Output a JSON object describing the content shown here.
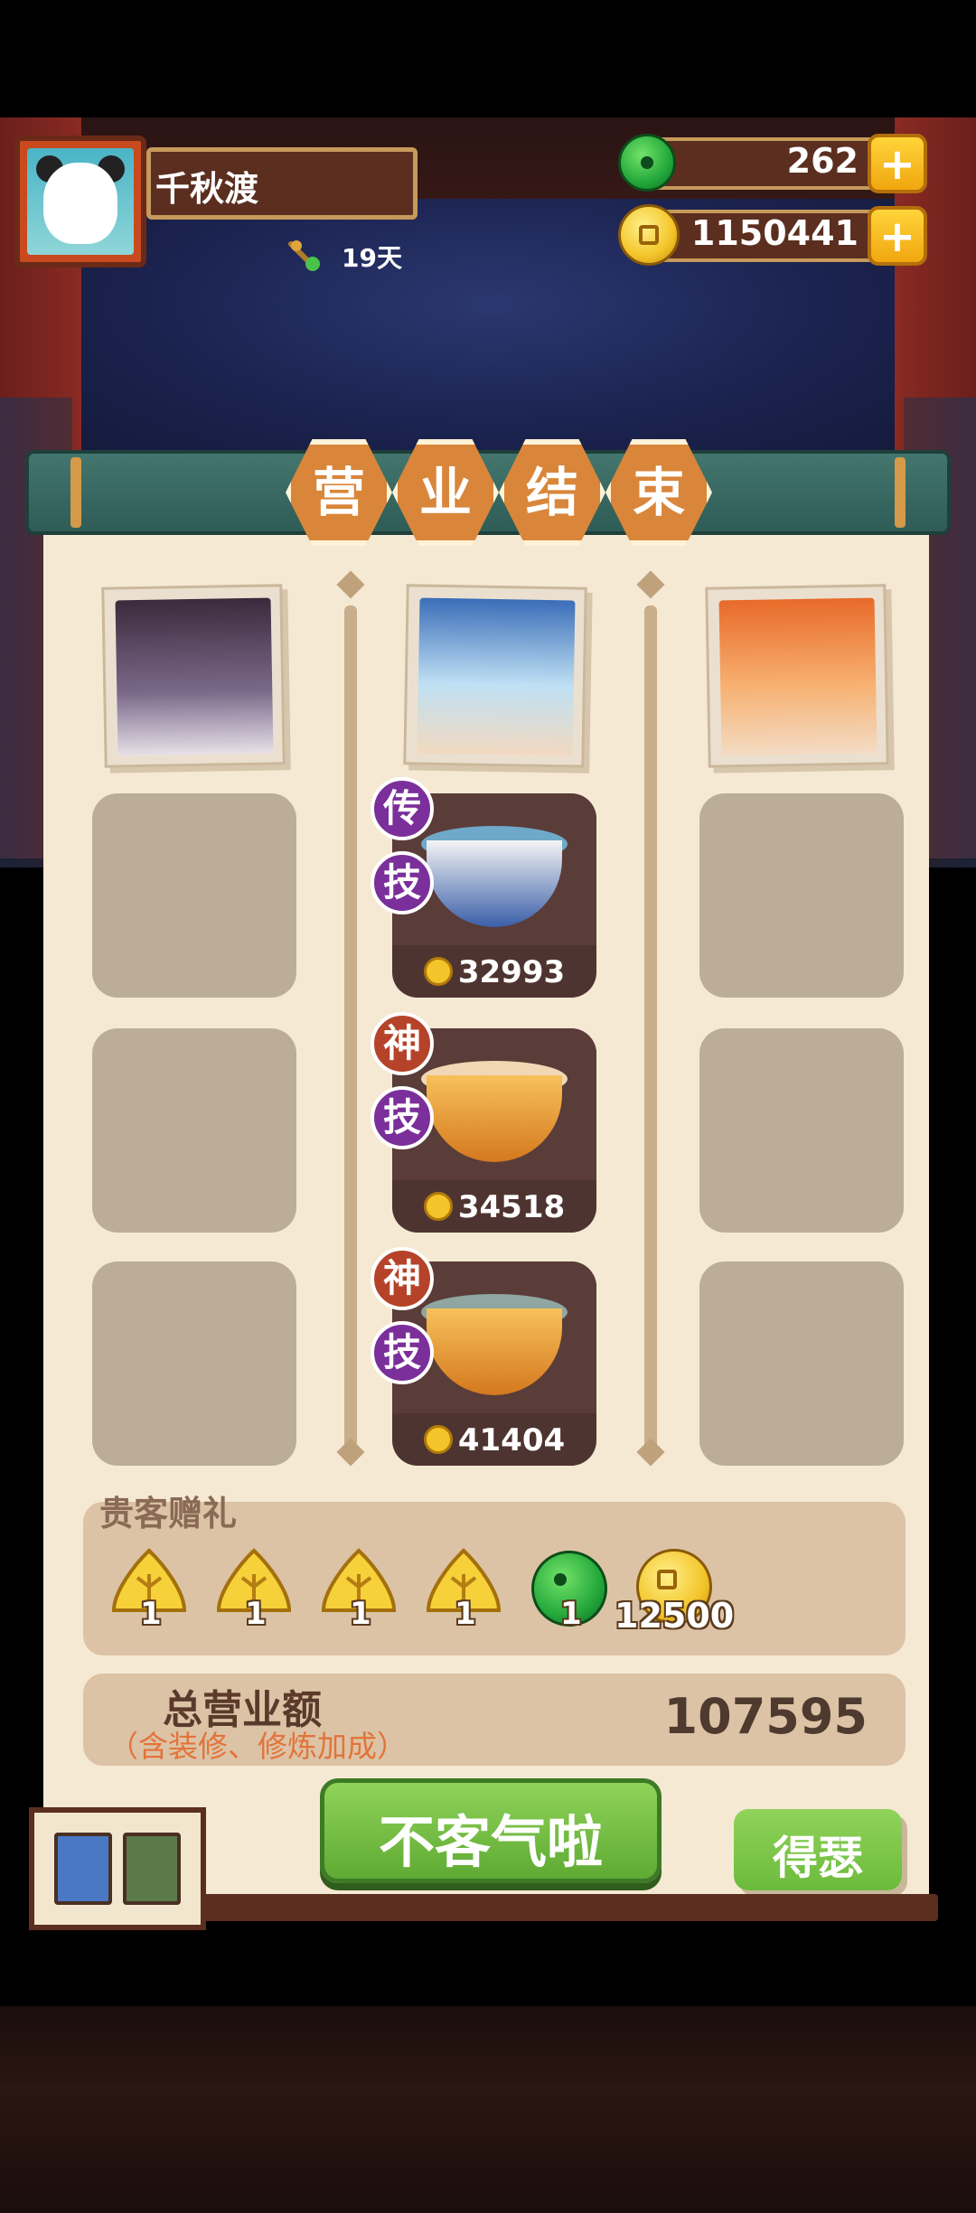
{
  "player": {
    "name": "千秋渡",
    "days": "19天"
  },
  "resources": {
    "jade": "262",
    "coins": "1150441",
    "add_symbol": "+"
  },
  "banner": {
    "chars": [
      "营",
      "业",
      "结",
      "束"
    ]
  },
  "customers": [
    {
      "name": "customer-left",
      "dishes": []
    },
    {
      "name": "customer-middle",
      "dishes": [
        {
          "badge_top": "传",
          "badge_bottom": "技",
          "price": "32993",
          "badge_top_color": "#7b2f9a"
        },
        {
          "badge_top": "神",
          "badge_bottom": "技",
          "price": "34518",
          "badge_top_color": "#b5432a"
        },
        {
          "badge_top": "神",
          "badge_bottom": "技",
          "price": "41404",
          "badge_top_color": "#b5432a"
        }
      ]
    },
    {
      "name": "customer-right",
      "dishes": []
    }
  ],
  "gifts": {
    "title": "贵客赠礼",
    "items": [
      {
        "icon": "ginkgo-icon",
        "count": "1"
      },
      {
        "icon": "ginkgo-icon",
        "count": "1"
      },
      {
        "icon": "ginkgo-icon",
        "count": "1"
      },
      {
        "icon": "ginkgo-icon",
        "count": "1"
      },
      {
        "icon": "jade-icon",
        "count": "1"
      },
      {
        "icon": "coin-icon",
        "count": "12500"
      }
    ]
  },
  "total": {
    "label": "总营业额",
    "sublabel": "（含装修、修炼加成）",
    "value": "107595"
  },
  "buttons": {
    "confirm": "不客气啦",
    "show_off": "得瑟"
  },
  "colors": {
    "accent_green": "#6cbb3c",
    "banner_orange": "#d9863a",
    "panel_bg": "#f6e9d4"
  }
}
